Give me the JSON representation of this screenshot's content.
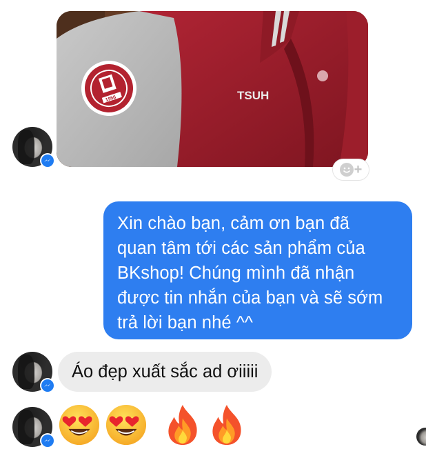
{
  "conversation": {
    "photo_message": {
      "alt_description": "",
      "jacket_patch_text": "HUST",
      "jacket_patch_year": "1956",
      "jacket_back_text": "TSUH"
    },
    "reaction_button": {
      "icon": "smiley-plus-icon",
      "symbol": "+"
    },
    "outgoing_message": {
      "lines": [
        "Xin chào bạn, cảm ơn bạn đã",
        "quan tâm tới các sản phẩm của",
        "BKshop! Chúng mình đã nhận",
        "được tin nhắn của bạn và sẽ sớm",
        "trả lời bạn nhé ^^"
      ]
    },
    "incoming_message": {
      "text": "Áo đẹp xuất sắc ad ơiiiii"
    },
    "emoji_message": {
      "emojis": [
        "heart-eyes-emoji",
        "heart-eyes-emoji",
        "fire-emoji",
        "fire-emoji"
      ]
    },
    "colors": {
      "outgoing_bubble": "#2e7ef0",
      "incoming_bubble": "#ececec",
      "messenger_badge": "#1f7cf2",
      "jacket_red": "#a3202e",
      "jacket_sleeve": "#bdbdbd"
    }
  }
}
